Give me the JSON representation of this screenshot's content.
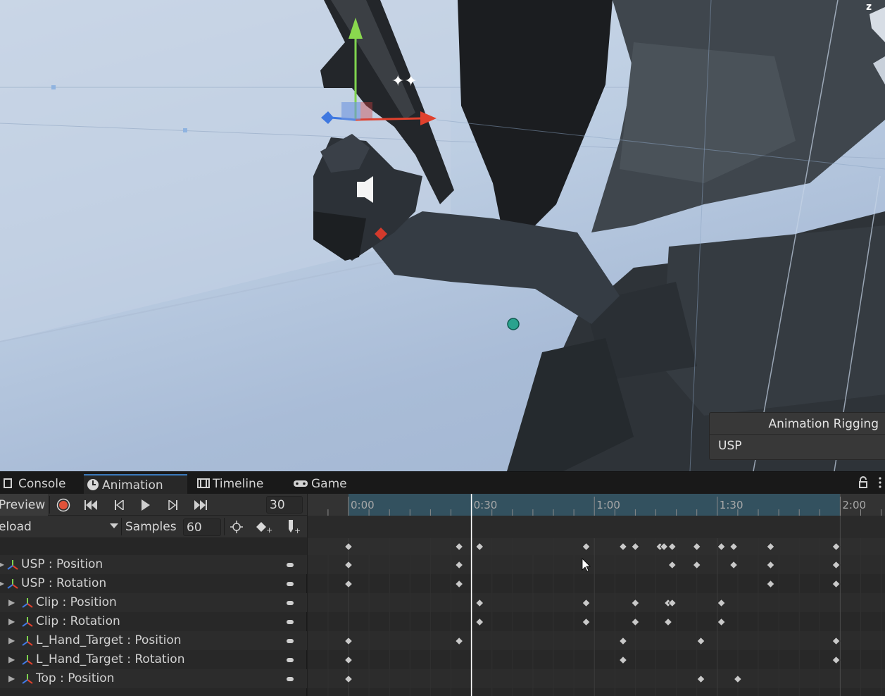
{
  "scene": {
    "overlay": {
      "title": "Animation Rigging",
      "item": "USP"
    },
    "gizmo_axis_label": "z"
  },
  "tabs": [
    {
      "label": "Console",
      "icon": "console-icon",
      "active": false
    },
    {
      "label": "Animation",
      "icon": "clock-icon",
      "active": true
    },
    {
      "label": "Timeline",
      "icon": "film-icon",
      "active": false
    },
    {
      "label": "Game",
      "icon": "gamepad-icon",
      "active": false
    }
  ],
  "animation": {
    "preview_label": "Preview",
    "current_frame": "30",
    "clip_name": "eload",
    "samples_label": "Samples",
    "samples_value": "60",
    "properties": [
      {
        "label": "USP : Position",
        "indent": 0
      },
      {
        "label": "USP : Rotation",
        "indent": 0
      },
      {
        "label": "Clip : Position",
        "indent": 1
      },
      {
        "label": "Clip : Rotation",
        "indent": 1
      },
      {
        "label": "L_Hand_Target : Position",
        "indent": 1
      },
      {
        "label": "L_Hand_Target : Rotation",
        "indent": 1
      },
      {
        "label": "Top : Position",
        "indent": 1
      }
    ]
  },
  "timeline": {
    "ticks": [
      "0:00",
      "0:30",
      "1:00",
      "1:30",
      "2:00"
    ],
    "clip_end_frame": 120,
    "playhead_frame": 30,
    "keyframe_rows": [
      [
        0,
        27,
        32,
        58,
        67,
        70,
        76,
        77,
        79,
        85,
        91,
        94,
        103,
        119
      ],
      [
        0,
        27,
        79,
        85,
        94,
        103,
        119
      ],
      [
        0,
        27,
        103,
        119
      ],
      [
        32,
        58,
        70,
        78,
        79,
        91
      ],
      [
        32,
        58,
        70,
        78,
        91
      ],
      [
        0,
        27,
        67,
        86,
        119
      ],
      [
        0,
        67,
        119
      ],
      [
        0,
        86,
        95
      ]
    ]
  }
}
